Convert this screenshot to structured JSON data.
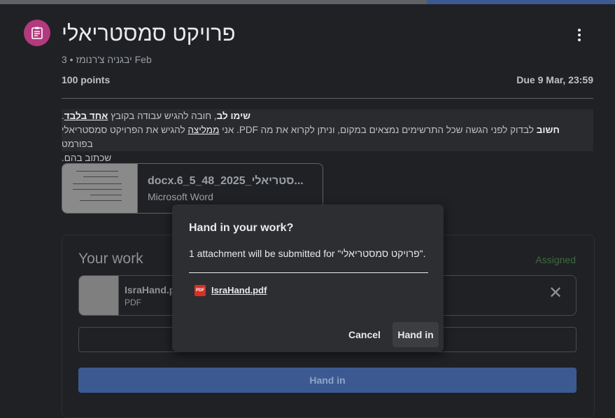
{
  "assignment": {
    "title": "פרויקט סמסטריאלי",
    "author": "יבגניה צ'רנומז",
    "date": "3 Feb",
    "points": "100 points",
    "due": "Due 9 Mar, 23:59",
    "accent_color": "#b23a7e"
  },
  "instructions": {
    "line1_bold": "שימו לב",
    "line1_text": ", חובה להגיש עבודה בקובץ ",
    "line1_underline": "אחד בלבד",
    "line1_end": ".",
    "line2_bold": "חשוב",
    "line2_text": " לבדוק לפני הגשה שכל התרשימים נמצאים במקום, וניתן לקרוא את מה ",
    "line2_pdf": "PDF. אני ",
    "line2_underline": "ממליצה",
    "line2_end": " להגיש את הפרויקט סמסטריאלי בפורמט",
    "line3": "שכתוב בהם."
  },
  "attachment": {
    "name": "docx.6_5_48_2025_סטריאלי...",
    "type": "Microsoft Word"
  },
  "your_work": {
    "title": "Your work",
    "status": "Assigned",
    "file_name": "IsraHand.p",
    "file_type": "PDF",
    "hand_in_label": "Hand in"
  },
  "dialog": {
    "title": "Hand in your work?",
    "body": "1 attachment will be submitted for \"פרויקט סמסטריאלי\".",
    "file_icon_label": "PDF",
    "file_name": "IsraHand.pdf",
    "cancel_label": "Cancel",
    "hand_in_label": "Hand in"
  },
  "icons": {
    "assignment": "assignment-icon",
    "more": "more-vert-icon",
    "close": "close-icon",
    "pdf": "pdf-icon"
  }
}
